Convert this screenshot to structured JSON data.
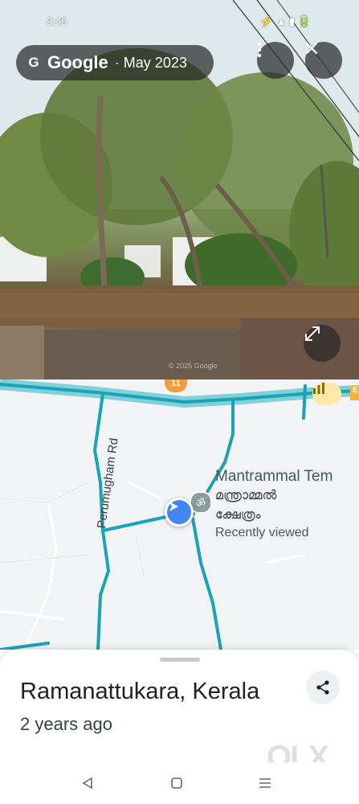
{
  "status_bar": {
    "time": "9:45",
    "right_icons": "⚡ ▲ ▮ 🔋"
  },
  "streetview": {
    "provider": "Google",
    "separator": "·",
    "date": "May 2023",
    "watermark": "© 2025 Google"
  },
  "map": {
    "road_name": "Perumugham Rd",
    "place_en": "Mantrammal Tem",
    "place_ml_line1": "മന്ത്രാമ്മൽ",
    "place_ml_line2": "ക്ഷേത്രം",
    "place_status": "Recently viewed",
    "road_badge": "11",
    "edge_badge": "E",
    "accent_color": "#4285f4",
    "road_color": "#1aa3b5"
  },
  "sheet": {
    "location": "Ramanattukara, Kerala",
    "time_ago": "2 years ago"
  },
  "overlay_logo": "OLX",
  "icons": {
    "more": "more-vert-icon",
    "close": "close-icon",
    "expand": "expand-icon",
    "share": "share-icon",
    "back": "back-icon",
    "home": "home-icon",
    "recents": "recents-icon"
  }
}
